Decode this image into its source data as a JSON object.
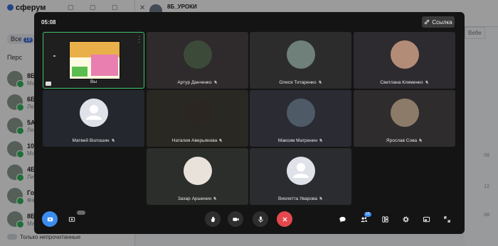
{
  "background_app": {
    "logo": "сферум",
    "filter_label": "Все",
    "filter_count": "19",
    "section_label": "Перс",
    "chats": [
      {
        "name": "8Б",
        "sub": "Ма"
      },
      {
        "name": "6Б",
        "sub": "Ле"
      },
      {
        "name": "5А",
        "sub": "Ле"
      },
      {
        "name": "10",
        "sub": "Ма"
      },
      {
        "name": "4Б",
        "sub": "Ли"
      },
      {
        "name": "Гор",
        "sub": "Фа"
      },
      {
        "name": "8Б",
        "sub": "Ма"
      }
    ],
    "unread_toggle": "Только непрочитанные",
    "chat_title": "8Б_УРОКИ",
    "right_tab": "Вебе",
    "times": [
      "08",
      "12",
      "08"
    ]
  },
  "call": {
    "timer": "05:08",
    "link_label": "Ссылка",
    "participants": [
      {
        "name": "Вы",
        "type": "screen",
        "muted": false
      },
      {
        "name": "Артур Данченко",
        "type": "photo",
        "muted": true,
        "color": "#3c4a3a"
      },
      {
        "name": "Олеся Титаренко",
        "type": "photo",
        "muted": true,
        "color": "#6f7f7a"
      },
      {
        "name": "Светлана Клименко",
        "type": "photo",
        "muted": true,
        "color": "#b28c77"
      },
      {
        "name": "Матвей Волошин",
        "type": "default",
        "muted": true
      },
      {
        "name": "Наталия Аверьянова",
        "type": "photo",
        "muted": true,
        "color": "#2b2622"
      },
      {
        "name": "Максим Матренин",
        "type": "photo",
        "muted": true,
        "color": "#4e5a66"
      },
      {
        "name": "Ярослав Сова",
        "type": "photo",
        "muted": true,
        "color": "#8c7b68"
      },
      {
        "name": "Захар Аршинин",
        "type": "photo",
        "muted": true,
        "color": "#e8e2da"
      },
      {
        "name": "Виолетта Уварова",
        "type": "default",
        "muted": true
      }
    ],
    "tile_backgrounds": [
      "#1f1f1f",
      "#2f2a2c",
      "#2b2c2b",
      "#2d2b2f",
      "#24272d",
      "#2a2823",
      "#2a2b33",
      "#2e2c2d",
      "#2b2e2a",
      "#2a2c30"
    ],
    "participants_count": "10",
    "accent_blue": "#3c8cf0",
    "end_red": "#e4484d"
  }
}
